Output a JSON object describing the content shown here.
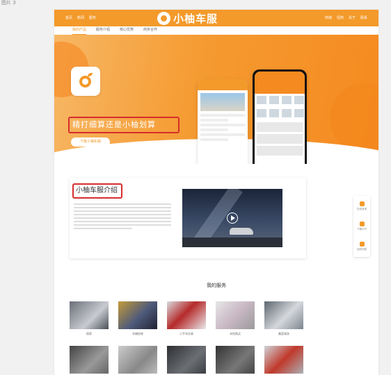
{
  "caption": "图片 3",
  "topbar": {
    "left_links": [
      "首页",
      "新闻",
      "服务"
    ],
    "right_links": [
      "商城",
      "招商",
      "关于",
      "联系"
    ],
    "brand": "小柚车服"
  },
  "subnav": {
    "items": [
      "我的产品",
      "服务介绍",
      "核心优势",
      "商务合作"
    ]
  },
  "hero": {
    "slogan": "精打细算还是小柚划算",
    "download_button": "下载小柚车服"
  },
  "intro": {
    "title": "小柚车服介绍"
  },
  "services": {
    "title": "我的服务",
    "items": [
      {
        "label": "保养"
      },
      {
        "label": "车辆检修"
      },
      {
        "label": "二手车交易"
      },
      {
        "label": "车险购买"
      },
      {
        "label": "美容清洗"
      }
    ]
  },
  "float_bar": {
    "items": [
      "在线咨询",
      "下载APP",
      "回到顶部"
    ]
  },
  "colors": {
    "brand": "#f39a2b",
    "highlight_border": "#d62d2d"
  }
}
